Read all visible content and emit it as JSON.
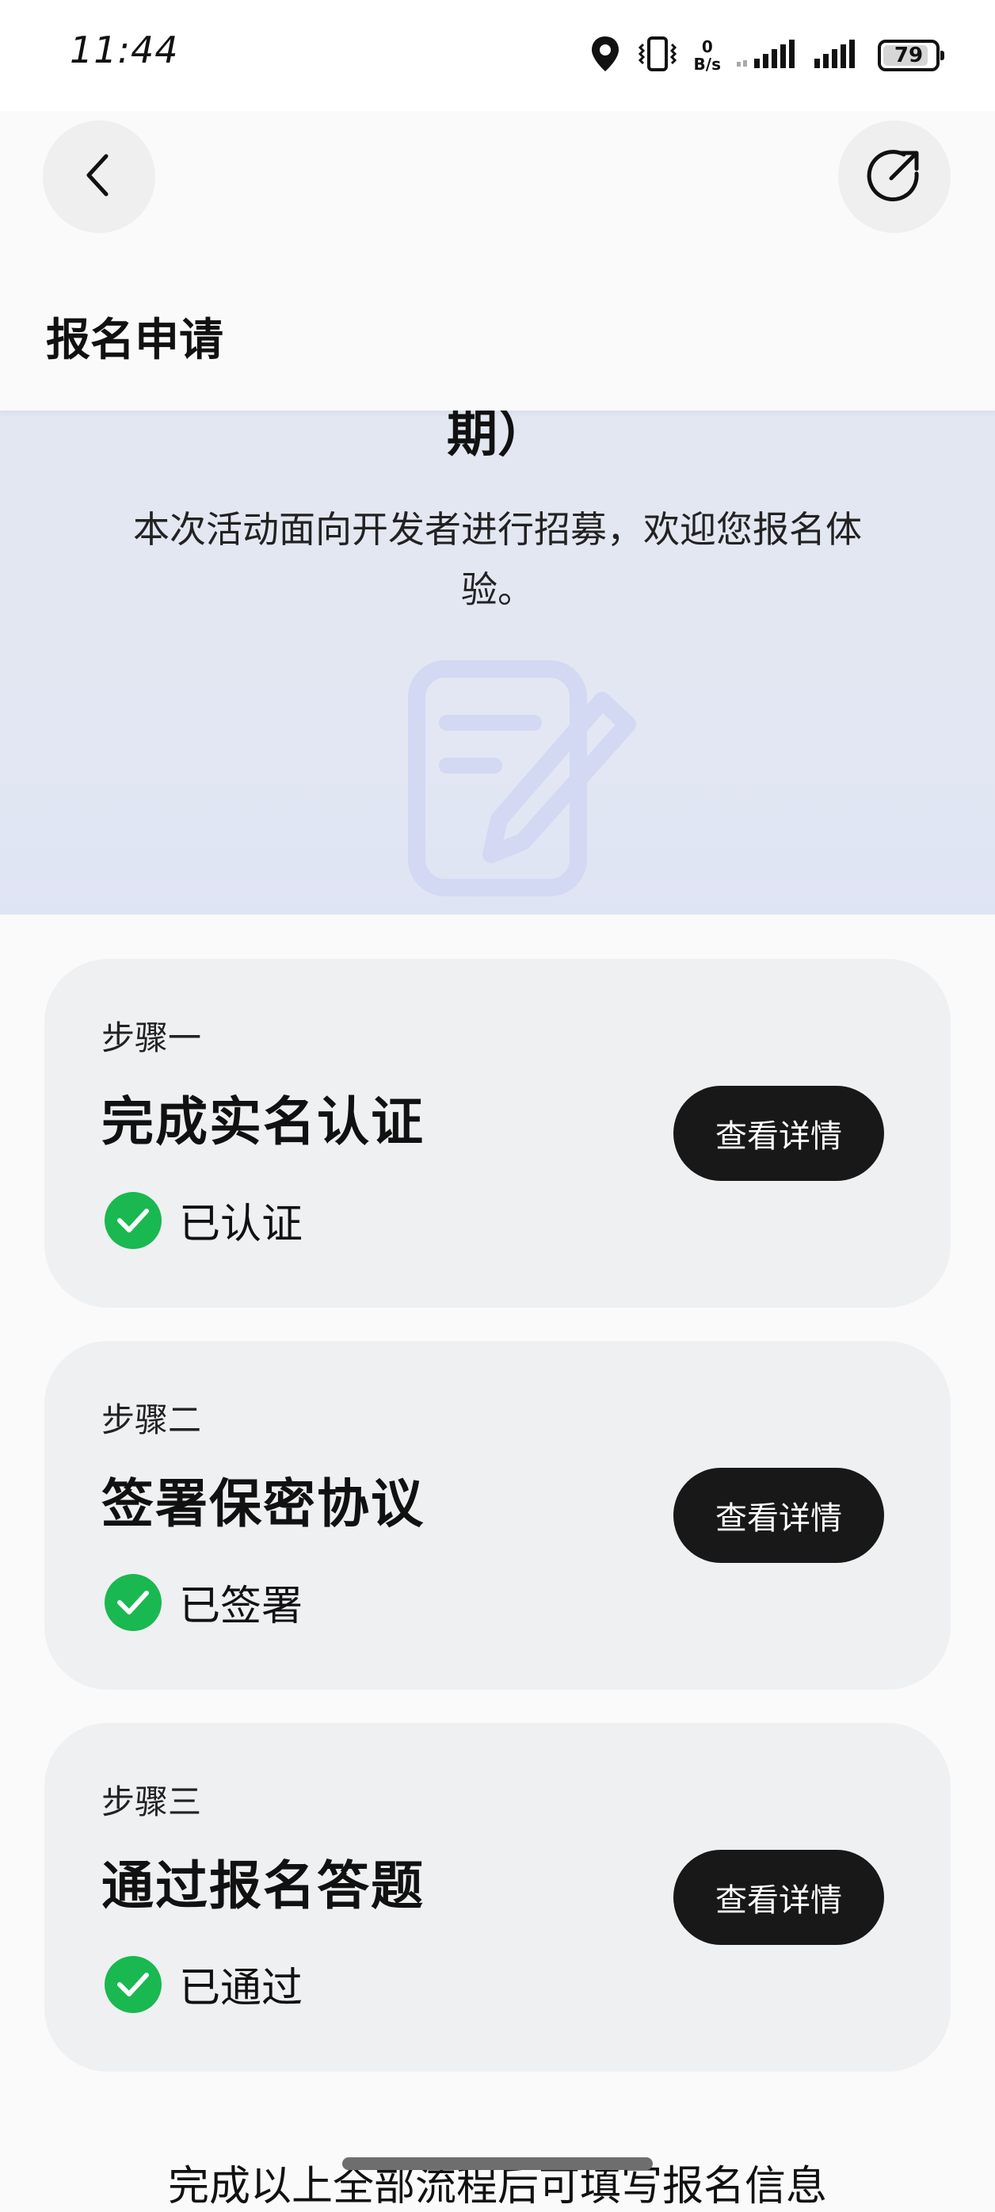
{
  "status_bar": {
    "time": "11:44",
    "net_speed_value": "0",
    "net_speed_unit": "B/s",
    "battery_level": "79",
    "icons": [
      "location-icon",
      "vibrate-icon",
      "signal-icon",
      "signal-icon"
    ]
  },
  "nav": {
    "back_icon": "chevron-left-icon",
    "share_icon": "share-icon"
  },
  "header": {
    "title": "报名申请"
  },
  "banner": {
    "title_tail": "期）",
    "description": "本次活动面向开发者进行招募，欢迎您报名体验。",
    "illustration": "document-edit-icon"
  },
  "steps": [
    {
      "kicker": "步骤一",
      "title": "完成实名认证",
      "status": "已认证",
      "button_label": "查看详情"
    },
    {
      "kicker": "步骤二",
      "title": "签署保密协议",
      "status": "已签署",
      "button_label": "查看详情"
    },
    {
      "kicker": "步骤三",
      "title": "通过报名答题",
      "status": "已通过",
      "button_label": "查看详情"
    }
  ],
  "footer": {
    "text": "完成以上全部流程后可填写报名信息"
  },
  "colors": {
    "accent_dark": "#181818",
    "success_green": "#1ab850",
    "banner_bg": "#e2e7f3",
    "card_bg": "#eff0f2"
  }
}
